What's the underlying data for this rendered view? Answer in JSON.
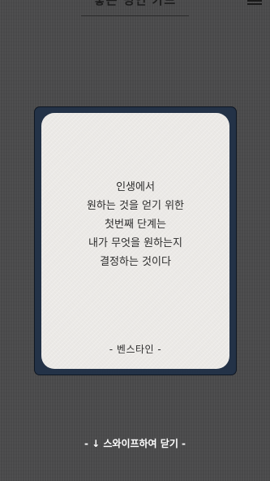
{
  "header": {
    "title": "좋은 명언 카드"
  },
  "card": {
    "quote_lines": [
      "인생에서",
      "원하는 것을 얻기 위한",
      "첫번째 단계는",
      "내가 무엇을 원하는지",
      "결정하는 것이다"
    ],
    "author": "- 벤스타인 -"
  },
  "footer": {
    "swipe_hint": "- ↓ 스와이프하여 닫기 -"
  },
  "colors": {
    "background": "#4a4a4b",
    "card_frame": "#233247",
    "card_paper": "#ebe9e6",
    "text": "#2d2d2d"
  },
  "icons": {
    "menu": "hamburger-menu-icon"
  }
}
